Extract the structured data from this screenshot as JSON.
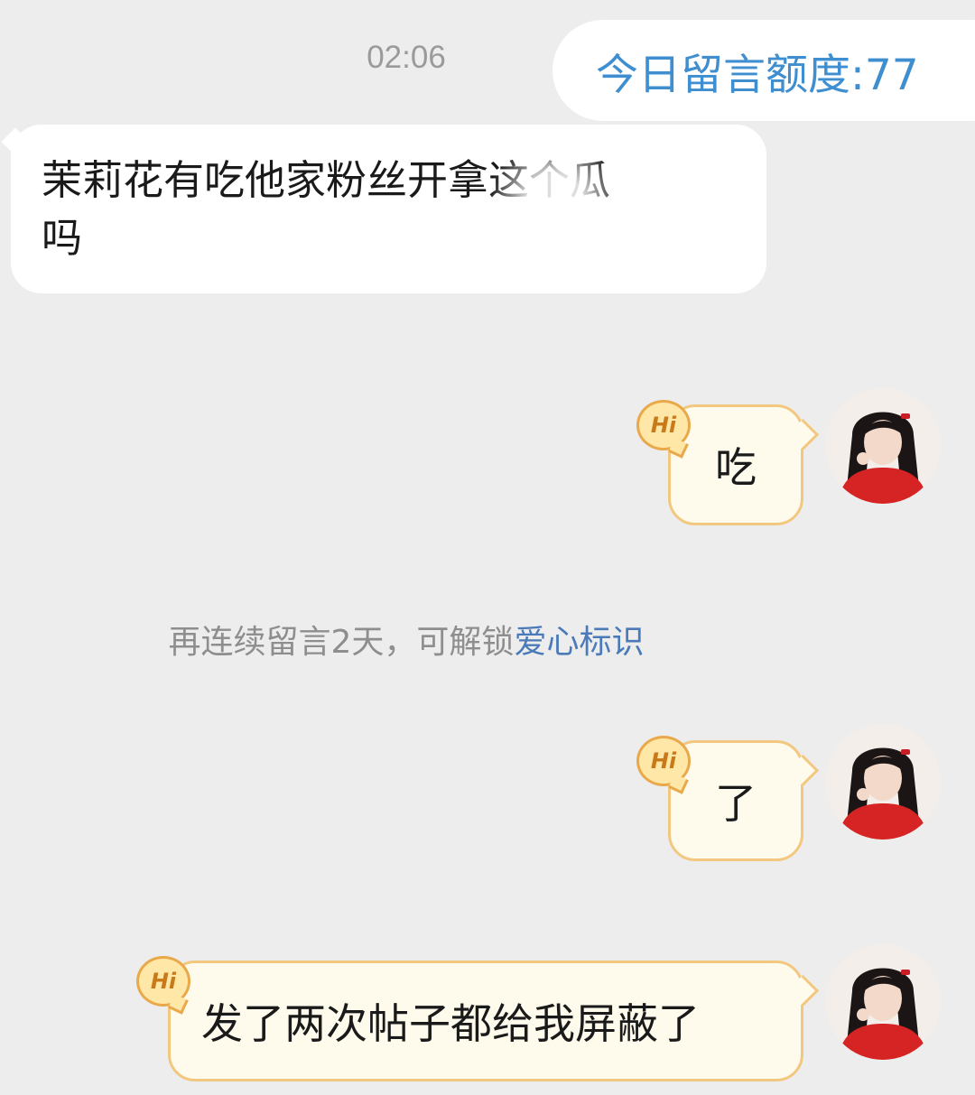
{
  "header": {
    "timestamp": "02:06",
    "quota_text": "今日留言额度:77"
  },
  "messages": [
    {
      "side": "incoming",
      "line1": "茉莉花有吃他家粉丝开拿这个瓜",
      "line2": "吗"
    },
    {
      "side": "outgoing",
      "text": "吃",
      "badge": "Hi",
      "avatar": "user-avatar"
    },
    {
      "side": "outgoing",
      "text": "了",
      "badge": "Hi",
      "avatar": "user-avatar"
    },
    {
      "side": "outgoing",
      "text": "发了两次帖子都给我屏蔽了",
      "badge": "Hi",
      "avatar": "user-avatar"
    }
  ],
  "streak_note": {
    "prefix": "再连续留言2天，可解锁",
    "link": "爱心标识"
  },
  "colors": {
    "background": "#ededed",
    "quota_text": "#3e8ed0",
    "outgoing_bubble": "#fffbec",
    "outgoing_border": "#f2c880",
    "badge": "#e9a94a",
    "link": "#4a7bb8"
  }
}
